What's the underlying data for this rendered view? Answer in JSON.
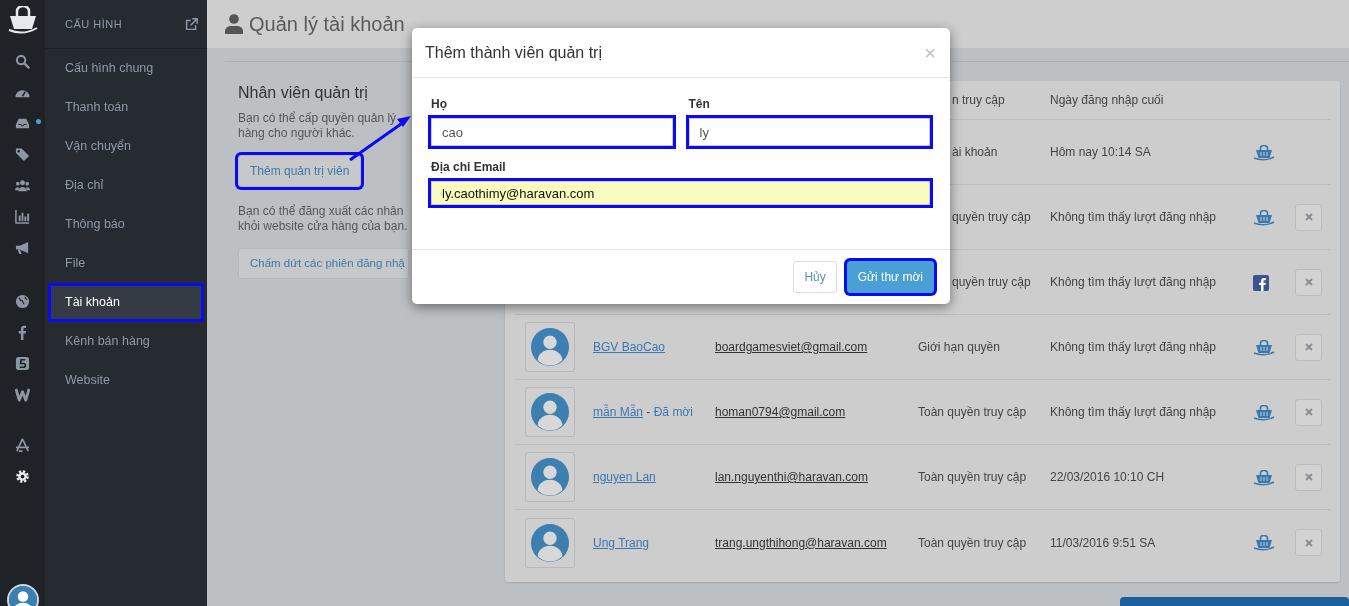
{
  "rail": {
    "groups": [
      [
        {
          "kind": "search",
          "dot": false
        },
        {
          "kind": "dashboard",
          "dot": false
        },
        {
          "kind": "inbox",
          "dot": true
        },
        {
          "kind": "tags",
          "dot": false
        },
        {
          "kind": "users",
          "dot": false
        },
        {
          "kind": "chart",
          "dot": false
        },
        {
          "kind": "megaphone",
          "dot": false
        }
      ],
      [
        {
          "kind": "globe",
          "dot": false
        },
        {
          "kind": "facebook",
          "dot": false
        },
        {
          "kind": "five",
          "dot": false
        },
        {
          "kind": "w",
          "dot": false
        }
      ],
      [
        {
          "kind": "appstore",
          "dot": false
        },
        {
          "kind": "gear",
          "dot": false
        }
      ]
    ]
  },
  "sidebar": {
    "title": "CẤU HÌNH",
    "items": [
      {
        "label": "Cấu hình chung",
        "selected": false,
        "highlighted": false
      },
      {
        "label": "Thanh toán",
        "selected": false,
        "highlighted": false
      },
      {
        "label": "Vận chuyển",
        "selected": false,
        "highlighted": false
      },
      {
        "label": "Địa chỉ",
        "selected": false,
        "highlighted": false
      },
      {
        "label": "Thông báo",
        "selected": false,
        "highlighted": false
      },
      {
        "label": "File",
        "selected": false,
        "highlighted": false
      },
      {
        "label": "Tài khoản",
        "selected": true,
        "highlighted": true
      },
      {
        "label": "Kênh bán hàng",
        "selected": false,
        "highlighted": false
      },
      {
        "label": "Website",
        "selected": false,
        "highlighted": false
      }
    ]
  },
  "page": {
    "title": "Quản lý tài khoản"
  },
  "staff_panel": {
    "heading": "Nhân viên quản trị",
    "intro_lines": [
      "Bạn có thể cấp quyền quản lý",
      "hàng cho người khác."
    ],
    "add_button": {
      "label": "Thêm quản trị viên",
      "highlighted": true
    },
    "logout_lines": [
      "Bạn có thể đăng xuất các nhân",
      "khỏi website cửa hàng của bạn."
    ],
    "logout_button": {
      "label": "Chấm dứt các phiên đăng nhậ",
      "highlighted": false
    }
  },
  "table": {
    "header": {
      "role": "n truy cập",
      "last_login": "Ngày đăng nhập cuối"
    },
    "rows": [
      {
        "role": "ài khoản",
        "last_login": "Hôm nay 10:14 SA",
        "kind": "haravan",
        "removable": false
      },
      {
        "role": "quyền truy cập",
        "last_login": "Không tìm thấy lượt đăng nhập",
        "kind": "haravan",
        "removable": true
      },
      {
        "role": "quyền truy cập",
        "last_login": "Không tìm thấy lượt đăng nhập",
        "kind": "facebook",
        "removable": true
      },
      {
        "name": "BGV BaoCao",
        "email": "boardgamesviet@gmail.com",
        "role": "Giới hạn quyền",
        "last_login": "Không tìm thấy lượt đăng nhập",
        "kind": "haravan",
        "removable": true
      },
      {
        "name": "mẫn Mẫn",
        "note_separator": "-",
        "note": "Đã mời",
        "email": "homan0794@gmail.com",
        "role": "Toàn quyền truy cập",
        "last_login": "Không tìm thấy lượt đăng nhập",
        "kind": "haravan",
        "removable": true
      },
      {
        "name": "nguyen Lan",
        "email": "lan.nguyenthi@haravan.com",
        "role": "Toàn quyền truy cập",
        "last_login": "22/03/2016 10:10 CH",
        "kind": "haravan",
        "removable": true
      },
      {
        "name": "Ung Trang",
        "email": "trang.ungthihong@haravan.com",
        "role": "Toàn quyền truy cập",
        "last_login": "11/03/2016 9:51 SA",
        "kind": "haravan",
        "removable": true
      }
    ]
  },
  "dialog": {
    "title": "Thêm thành viên quản trị",
    "close": "×",
    "name_fields": [
      {
        "label": "Họ",
        "value": "cao",
        "highlighted": true,
        "autofilled": false
      },
      {
        "label": "Tên",
        "value": "ly",
        "highlighted": true,
        "autofilled": false
      }
    ],
    "email_field": {
      "label": "Địa chỉ Email",
      "value": "ly.caothimy@haravan.com",
      "highlighted": true,
      "autofilled": true
    },
    "buttons": [
      {
        "label": "Hủy",
        "kind": "secondary",
        "highlighted": false
      },
      {
        "label": "Gửi thư mời",
        "kind": "primary",
        "highlighted": true
      }
    ]
  }
}
